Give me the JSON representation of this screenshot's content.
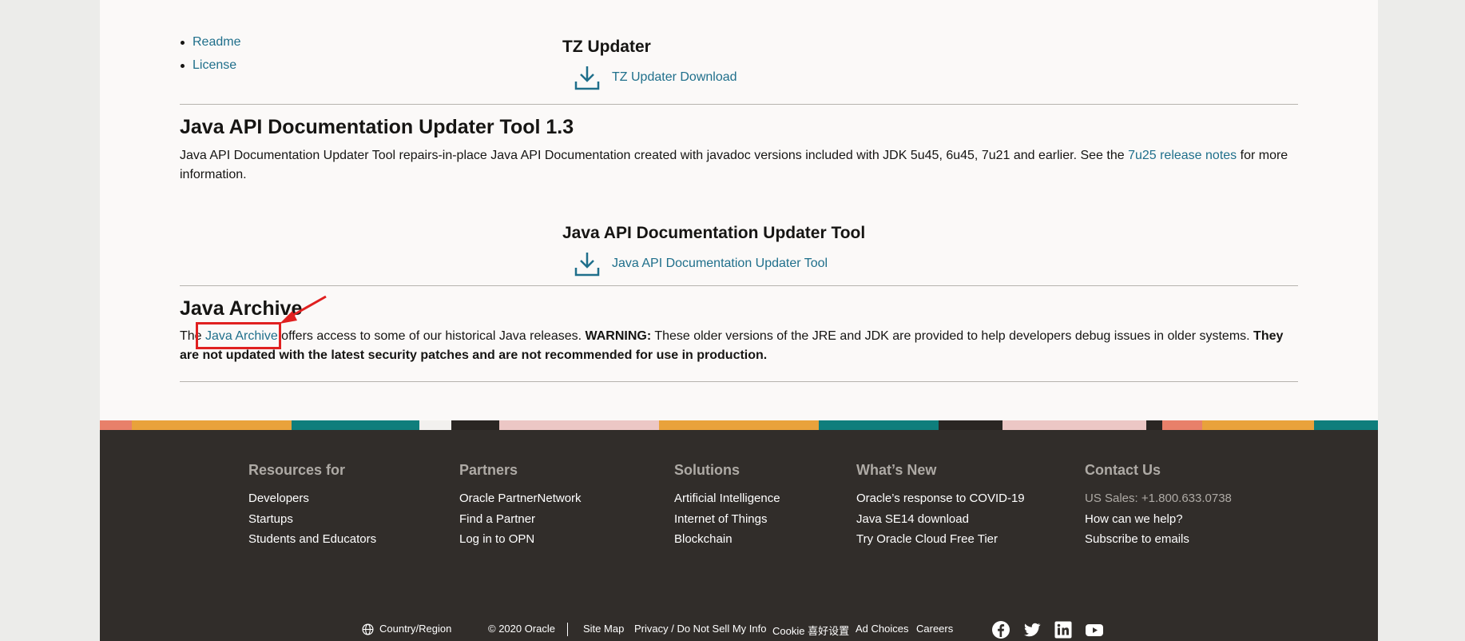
{
  "links": {
    "readme": "Readme",
    "license": "License"
  },
  "tz": {
    "title": "TZ Updater",
    "download": "TZ Updater Download"
  },
  "apidoc": {
    "heading": "Java API Documentation Updater Tool 1.3",
    "desc_prefix": "Java API Documentation Updater Tool repairs-in-place Java API Documentation created with javadoc versions included with JDK 5u45, 6u45, 7u21 and earlier.  See the ",
    "notes_link": "7u25 release notes",
    "desc_suffix": " for more information.",
    "tool_title": "Java API Documentation Updater Tool",
    "tool_link": "Java API Documentation Updater Tool"
  },
  "archive": {
    "heading": "Java Archive",
    "p1": "The ",
    "link": "Java Archive",
    "p2": " offers access to some of our historical Java releases. ",
    "warning": "WARNING:",
    "p3": " These older versions of the JRE and JDK are provided to help developers debug issues in older systems. ",
    "bold": "They are not updated with the latest security patches and are not recommended for use in production."
  },
  "footer": {
    "resources": {
      "title": "Resources for",
      "items": [
        "Developers",
        "Startups",
        "Students and Educators"
      ]
    },
    "partners": {
      "title": "Partners",
      "items": [
        "Oracle PartnerNetwork",
        "Find a Partner",
        "Log in to OPN"
      ]
    },
    "solutions": {
      "title": "Solutions",
      "items": [
        "Artificial Intelligence",
        "Internet of Things",
        "Blockchain"
      ]
    },
    "whatsnew": {
      "title": "What’s New",
      "items": [
        "Oracle’s response to COVID-19",
        "Java SE14 download",
        "Try Oracle Cloud Free Tier"
      ]
    },
    "contact": {
      "title": "Contact Us",
      "sales": "US Sales: +1.800.633.0738",
      "items": [
        "How can we help?",
        "Subscribe to emails"
      ]
    },
    "bottom": {
      "country": "Country/Region",
      "copyright": "© 2020 Oracle",
      "sitemap": "Site Map",
      "privacy": "Privacy / Do Not Sell My Info",
      "cookie": "Cookie 喜好设置",
      "adchoices": "Ad Choices",
      "careers": "Careers"
    }
  },
  "colors": {
    "link": "#1f6f8b",
    "footer_bg": "#312d2a",
    "highlight": "#e02020",
    "page_bg": "#fbf9f8"
  },
  "icons": [
    "download-icon",
    "arrow-icon",
    "globe-icon",
    "facebook-icon",
    "twitter-icon",
    "linkedin-icon",
    "youtube-icon"
  ]
}
